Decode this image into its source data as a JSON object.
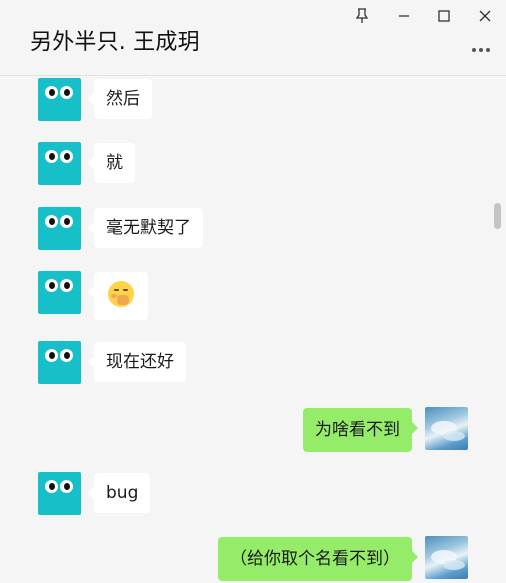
{
  "window": {
    "title": "另外半只. 王成玥",
    "controls": [
      "pin-icon",
      "minimize-icon",
      "maximize-icon",
      "close-icon"
    ],
    "more_icon": "more-icon"
  },
  "colors": {
    "incoming_bubble": "#ffffff",
    "outgoing_bubble": "#95ec69",
    "avatar_teal": "#17c0c9",
    "background": "#f5f5f5"
  },
  "messages": [
    {
      "direction": "in",
      "text": "然后"
    },
    {
      "direction": "in",
      "text": "就"
    },
    {
      "direction": "in",
      "text": "毫无默契了"
    },
    {
      "direction": "in",
      "text": "",
      "emoji": "shy-face-emoji"
    },
    {
      "direction": "in",
      "text": "现在还好"
    },
    {
      "direction": "out",
      "text": "为啥看不到"
    },
    {
      "direction": "in",
      "text": "bug"
    },
    {
      "direction": "out",
      "text": "（给你取个名看不到）"
    }
  ]
}
